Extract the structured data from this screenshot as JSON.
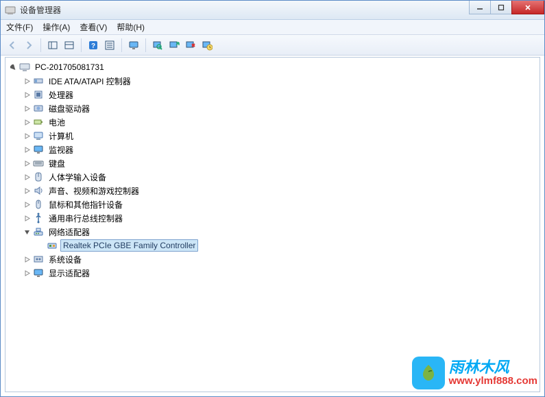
{
  "window": {
    "title": "设备管理器"
  },
  "menubar": [
    "文件(F)",
    "操作(A)",
    "查看(V)",
    "帮助(H)"
  ],
  "toolbar_icons": [
    "back-icon",
    "forward-icon",
    "sep",
    "frame1-icon",
    "frame2-icon",
    "sep",
    "help-icon",
    "props-icon",
    "sep",
    "monitor-icon",
    "sep",
    "scan-icon",
    "enable-icon",
    "remove-icon",
    "update-icon"
  ],
  "tree": {
    "root": {
      "label": "PC-201705081731",
      "icon": "computer-icon"
    },
    "nodes": [
      {
        "label": "IDE ATA/ATAPI 控制器",
        "icon": "ide-icon",
        "expander": "closed"
      },
      {
        "label": "处理器",
        "icon": "cpu-icon",
        "expander": "closed"
      },
      {
        "label": "磁盘驱动器",
        "icon": "disk-icon",
        "expander": "closed"
      },
      {
        "label": "电池",
        "icon": "battery-icon",
        "expander": "closed"
      },
      {
        "label": "计算机",
        "icon": "pc-icon",
        "expander": "closed"
      },
      {
        "label": "监视器",
        "icon": "monitor-icon",
        "expander": "closed"
      },
      {
        "label": "键盘",
        "icon": "keyboard-icon",
        "expander": "closed"
      },
      {
        "label": "人体学输入设备",
        "icon": "hid-icon",
        "expander": "closed"
      },
      {
        "label": "声音、视频和游戏控制器",
        "icon": "audio-icon",
        "expander": "closed"
      },
      {
        "label": "鼠标和其他指针设备",
        "icon": "mouse-icon",
        "expander": "closed"
      },
      {
        "label": "通用串行总线控制器",
        "icon": "usb-icon",
        "expander": "closed"
      },
      {
        "label": "网络适配器",
        "icon": "network-icon",
        "expander": "open",
        "children": [
          {
            "label": "Realtek PCIe GBE Family Controller",
            "icon": "nic-icon",
            "selected": true
          }
        ]
      },
      {
        "label": "系统设备",
        "icon": "system-icon",
        "expander": "closed"
      },
      {
        "label": "显示适配器",
        "icon": "display-icon",
        "expander": "closed"
      }
    ]
  },
  "watermark": {
    "text_cn": "雨林木风",
    "url": "www.ylmf888.com"
  }
}
